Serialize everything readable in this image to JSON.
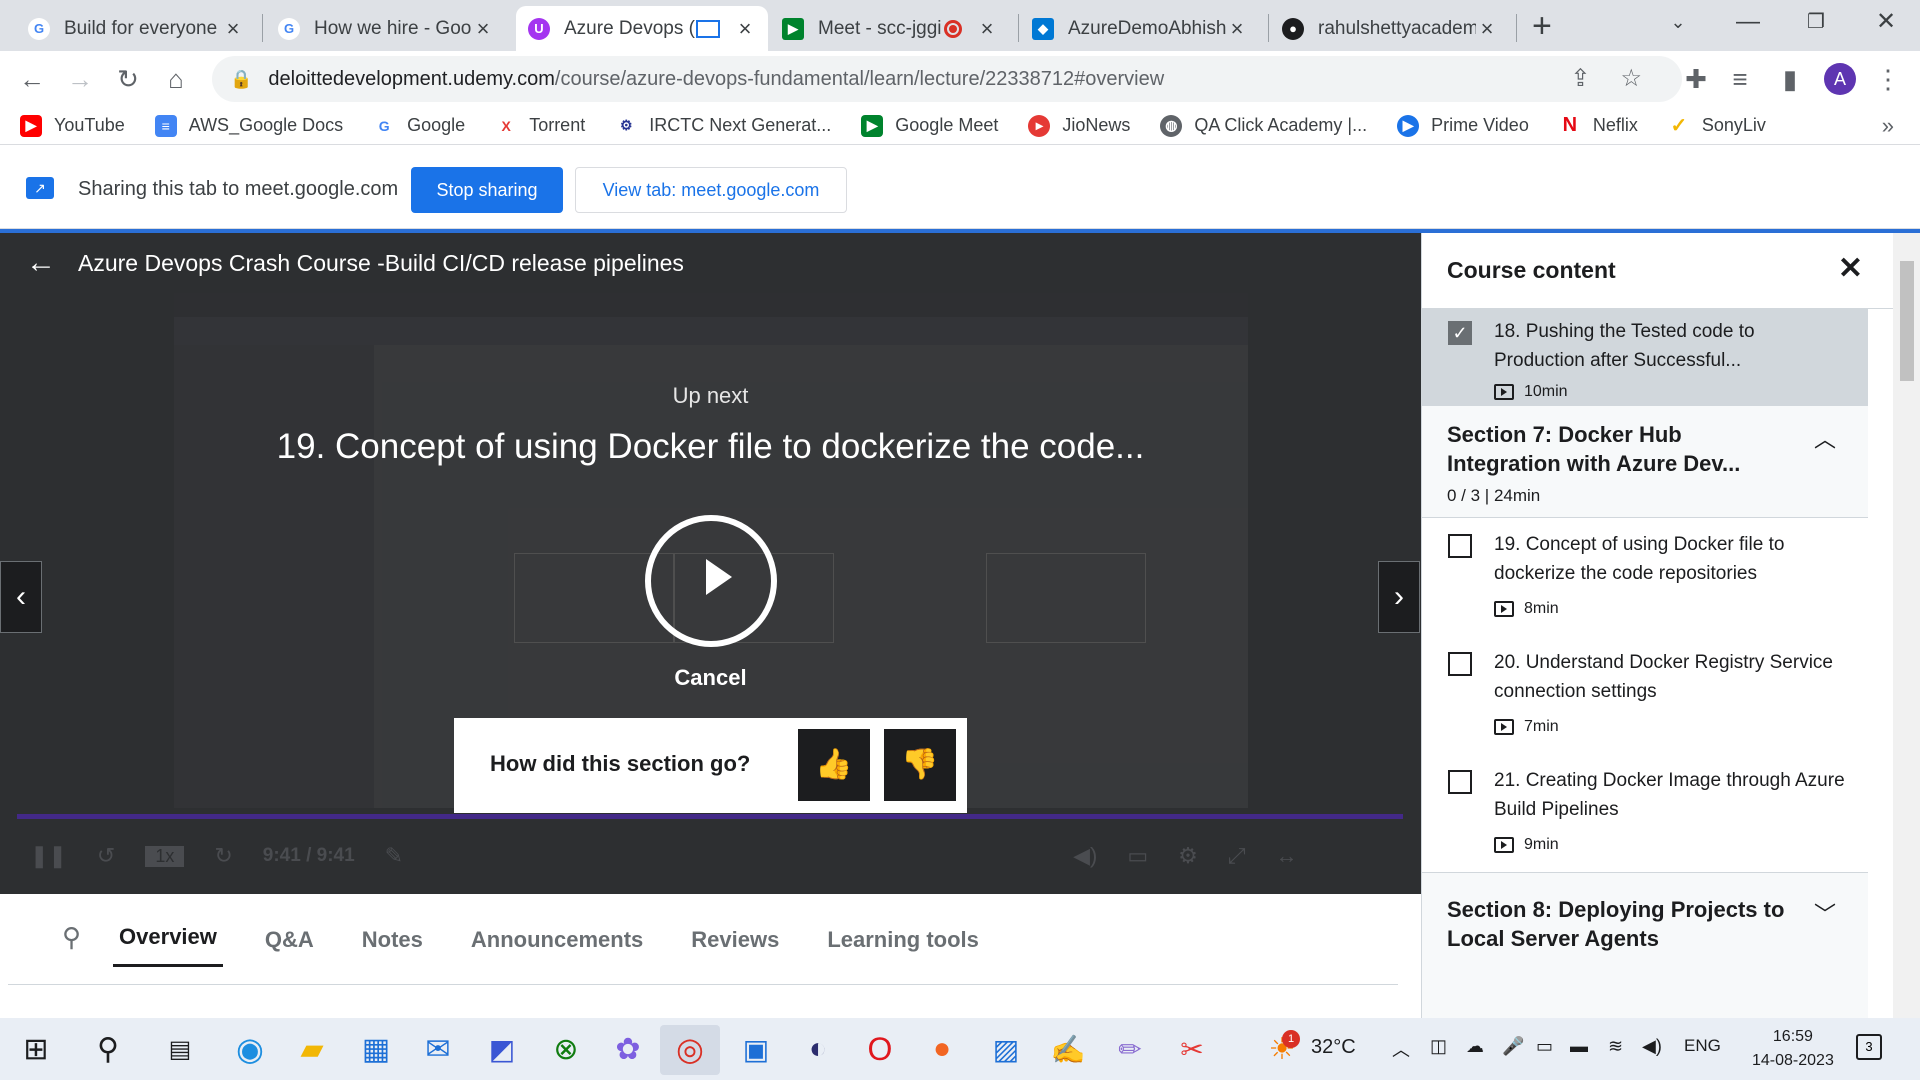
{
  "browser": {
    "tabs": [
      {
        "title": "Build for everyone",
        "favicon": "google-icon",
        "color": "#4285f4",
        "active": false
      },
      {
        "title": "How we hire - Goo",
        "favicon": "google-icon",
        "color": "#4285f4",
        "active": false
      },
      {
        "title": "Azure Devops (",
        "favicon": "udemy-icon",
        "color": "#a435f0",
        "active": true
      },
      {
        "title": "Meet - scc-jggi",
        "favicon": "meet-icon",
        "color": "#00832d",
        "active": false
      },
      {
        "title": "AzureDemoAbhishe",
        "favicon": "azure-devops-icon",
        "color": "#0078d4",
        "active": false
      },
      {
        "title": "rahulshettyacadem",
        "favicon": "github-icon",
        "color": "#1c1d1f",
        "active": false
      }
    ],
    "url_host": "deloittedevelopment.udemy.com",
    "url_path": "/course/azure-devops-fundamental/learn/lecture/22338712#overview",
    "avatar_letter": "A",
    "bookmarks": [
      {
        "label": "YouTube",
        "icon": "youtube-icon",
        "color": "#ff0000"
      },
      {
        "label": "AWS_Google Docs",
        "icon": "docs-icon",
        "color": "#4285f4"
      },
      {
        "label": "Google",
        "icon": "google-icon",
        "color": "#4285f4"
      },
      {
        "label": "Torrent",
        "icon": "torrent-icon",
        "color": "#e53935"
      },
      {
        "label": "IRCTC Next Generat...",
        "icon": "irctc-icon",
        "color": "#283593"
      },
      {
        "label": "Google Meet",
        "icon": "meet-icon",
        "color": "#00832d"
      },
      {
        "label": "JioNews",
        "icon": "jionews-icon",
        "color": "#e53935"
      },
      {
        "label": "QA Click Academy |...",
        "icon": "globe-icon",
        "color": "#5f6368"
      },
      {
        "label": "Prime Video",
        "icon": "prime-video-icon",
        "color": "#1a73e8"
      },
      {
        "label": "Neflix",
        "icon": "netflix-icon",
        "color": "#e50914"
      },
      {
        "label": "SonyLiv",
        "icon": "sonyliv-icon",
        "color": "#f2b705"
      }
    ]
  },
  "sharebar": {
    "text": "Sharing this tab to meet.google.com",
    "stop_label": "Stop sharing",
    "view_label": "View tab: meet.google.com"
  },
  "player": {
    "course_title": "Azure Devops Crash Course -Build CI/CD release pipelines",
    "up_next_label": "Up next",
    "up_next_title": "19. Concept of using Docker file to dockerize the code...",
    "cancel_label": "Cancel",
    "feedback_question": "How did this section go?",
    "speed": "1x",
    "time": "9:41 / 9:41"
  },
  "course_tabs": {
    "items": [
      "Overview",
      "Q&A",
      "Notes",
      "Announcements",
      "Reviews",
      "Learning tools"
    ],
    "active": "Overview"
  },
  "sidebar": {
    "title": "Course content",
    "current_item": {
      "title": "18. Pushing the Tested code to Production after Successful...",
      "duration": "10min",
      "completed": true
    },
    "section7": {
      "title": "Section 7: Docker Hub Integration with Azure Dev...",
      "meta": "0 / 3 | 24min",
      "expanded": true
    },
    "lectures": [
      {
        "title": "19. Concept of using Docker file to dockerize the code repositories",
        "duration": "8min"
      },
      {
        "title": "20. Understand Docker Registry Service connection settings",
        "duration": "7min"
      },
      {
        "title": "21. Creating Docker Image through Azure Build Pipelines",
        "duration": "9min"
      }
    ],
    "section8": {
      "title": "Section 8: Deploying Projects to Local Server Agents",
      "expanded": false
    }
  },
  "taskbar": {
    "temperature": "32°C",
    "weather_badge": "1",
    "language": "ENG",
    "time": "16:59",
    "date": "14-08-2023",
    "notifications": "3"
  }
}
